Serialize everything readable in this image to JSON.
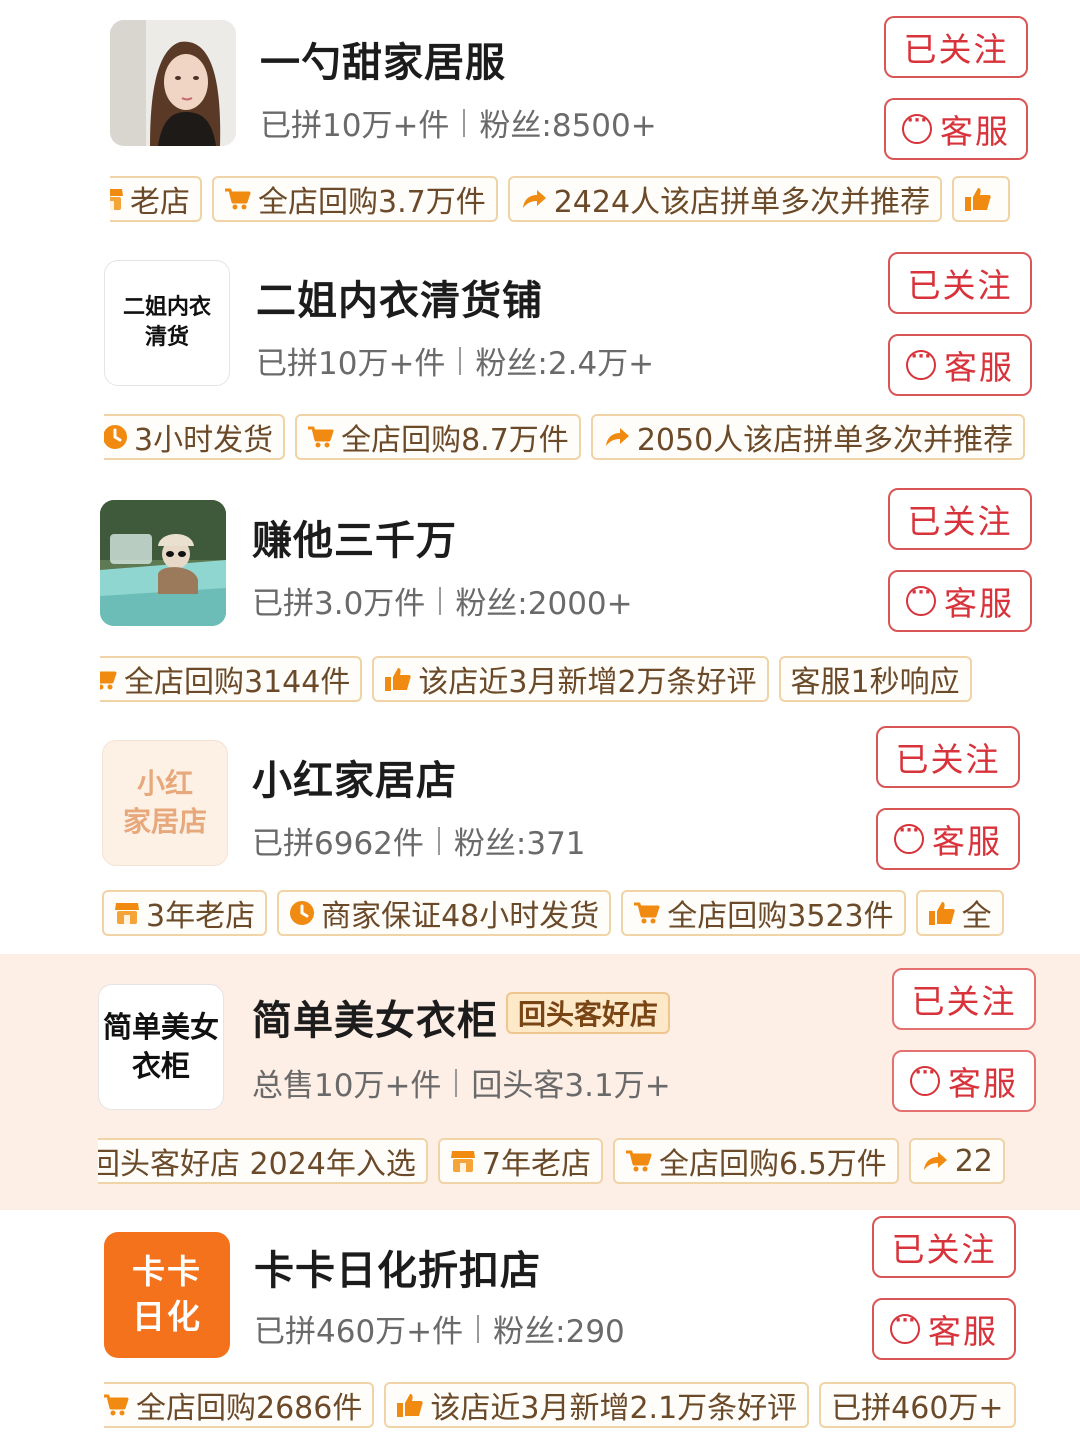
{
  "accent_color": "#d8323a",
  "tag_icon_color": "#f08a10",
  "stores": [
    {
      "name": "一勺甜家居服",
      "stats": [
        "已拼10万+件",
        "粉丝:8500+"
      ],
      "follow_label": "已关注",
      "service_label": "客服",
      "logo": {
        "type": "photo-girl",
        "text": ""
      },
      "tags": [
        {
          "icon": "shop-icon",
          "text": "老店"
        },
        {
          "icon": "cart-icon",
          "text": "全店回购3.7万件"
        },
        {
          "icon": "share-icon",
          "text": "2424人该店拼单多次并推荐"
        },
        {
          "icon": "thumb-up-icon",
          "text": ""
        }
      ]
    },
    {
      "name": "二姐内衣清货铺",
      "stats": [
        "已拼10万+件",
        "粉丝:2.4万+"
      ],
      "follow_label": "已关注",
      "service_label": "客服",
      "logo": {
        "type": "text",
        "text": "二姐内衣\n清货"
      },
      "tags": [
        {
          "icon": "clock-icon",
          "text": "3小时发货"
        },
        {
          "icon": "cart-icon",
          "text": "全店回购8.7万件"
        },
        {
          "icon": "share-icon",
          "text": "2050人该店拼单多次并推荐"
        }
      ]
    },
    {
      "name": "赚他三千万",
      "stats": [
        "已拼3.0万件",
        "粉丝:2000+"
      ],
      "follow_label": "已关注",
      "service_label": "客服",
      "logo": {
        "type": "photo-car",
        "text": ""
      },
      "tags": [
        {
          "icon": "cart-icon",
          "text": "全店回购3144件"
        },
        {
          "icon": "thumb-up-icon",
          "text": "该店近3月新增2万条好评"
        },
        {
          "icon": "",
          "text": "客服1秒响应"
        }
      ]
    },
    {
      "name": "小红家居店",
      "stats": [
        "已拼6962件",
        "粉丝:371"
      ],
      "follow_label": "已关注",
      "service_label": "客服",
      "logo": {
        "type": "text-peach",
        "text": "小红\n家居店"
      },
      "tags": [
        {
          "icon": "shop-icon",
          "text": "3年老店"
        },
        {
          "icon": "clock-icon",
          "text": "商家保证48小时发货"
        },
        {
          "icon": "cart-icon",
          "text": "全店回购3523件"
        },
        {
          "icon": "thumb-up-icon",
          "text": "全"
        }
      ]
    },
    {
      "name": "简单美女衣柜",
      "badge": "回头客好店",
      "stats": [
        "总售10万+件",
        "回头客3.1万+"
      ],
      "follow_label": "已关注",
      "service_label": "客服",
      "logo": {
        "type": "text",
        "text": "简单美女\n衣柜"
      },
      "highlighted": true,
      "tags": [
        {
          "icon": "",
          "text": "回头客好店 2024年入选"
        },
        {
          "icon": "shop-icon",
          "text": "7年老店"
        },
        {
          "icon": "cart-icon",
          "text": "全店回购6.5万件"
        },
        {
          "icon": "share-icon",
          "text": "22"
        }
      ]
    },
    {
      "name": "卡卡日化折扣店",
      "stats": [
        "已拼460万+件",
        "粉丝:290"
      ],
      "follow_label": "已关注",
      "service_label": "客服",
      "logo": {
        "type": "text-orange",
        "text": "卡卡\n日化"
      },
      "tags": [
        {
          "icon": "cart-icon",
          "text": "全店回购2686件"
        },
        {
          "icon": "thumb-up-icon",
          "text": "该店近3月新增2.1万条好评"
        },
        {
          "icon": "",
          "text": "已拼460万+"
        }
      ]
    }
  ]
}
